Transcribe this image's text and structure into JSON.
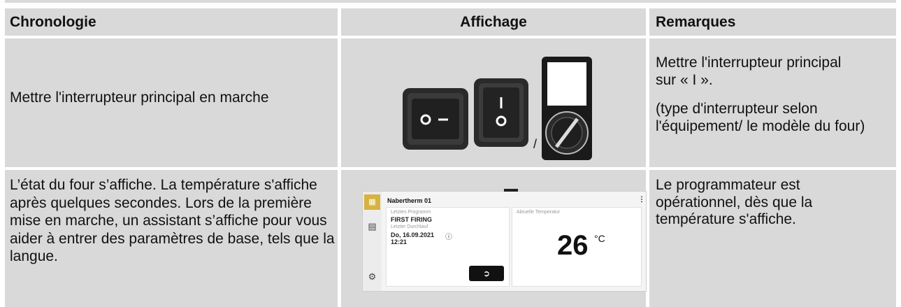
{
  "headers": {
    "col1": "Chronologie",
    "col2": "Affichage",
    "col3": "Remarques"
  },
  "row1": {
    "chronologie": "Mettre l'interrupteur principal en marche",
    "separator": "/",
    "remarques": [
      "Mettre l'interrupteur principal sur « I ».",
      "(type d'interrupteur selon l'équipement/ le modèle du four)"
    ]
  },
  "row2": {
    "chronologie": "L’état du four s’affiche. La température s'affiche après quelques secondes. Lors de la première mise en marche, un assistant s’affiche pour vous aider à entrer des paramètres de base, tels que la langue.",
    "remarques": "Le programmateur est opérationnel, dès que la température s'affiche.",
    "display": {
      "device_name": "Nabertherm 01",
      "last_program_label": "Letztes Programm",
      "last_program": "FIRST FIRING",
      "last_run_label": "Letzter Durchlauf",
      "last_run_date": "Do, 16.09.2021",
      "last_run_time": "12:21",
      "current_temp_label": "Aktuelle Temperatur",
      "temperature": "26",
      "unit": "°C"
    }
  },
  "icons": [
    "grid-icon",
    "chart-icon",
    "gear-icon",
    "info-icon",
    "kebab-menu-icon",
    "play-icon"
  ]
}
